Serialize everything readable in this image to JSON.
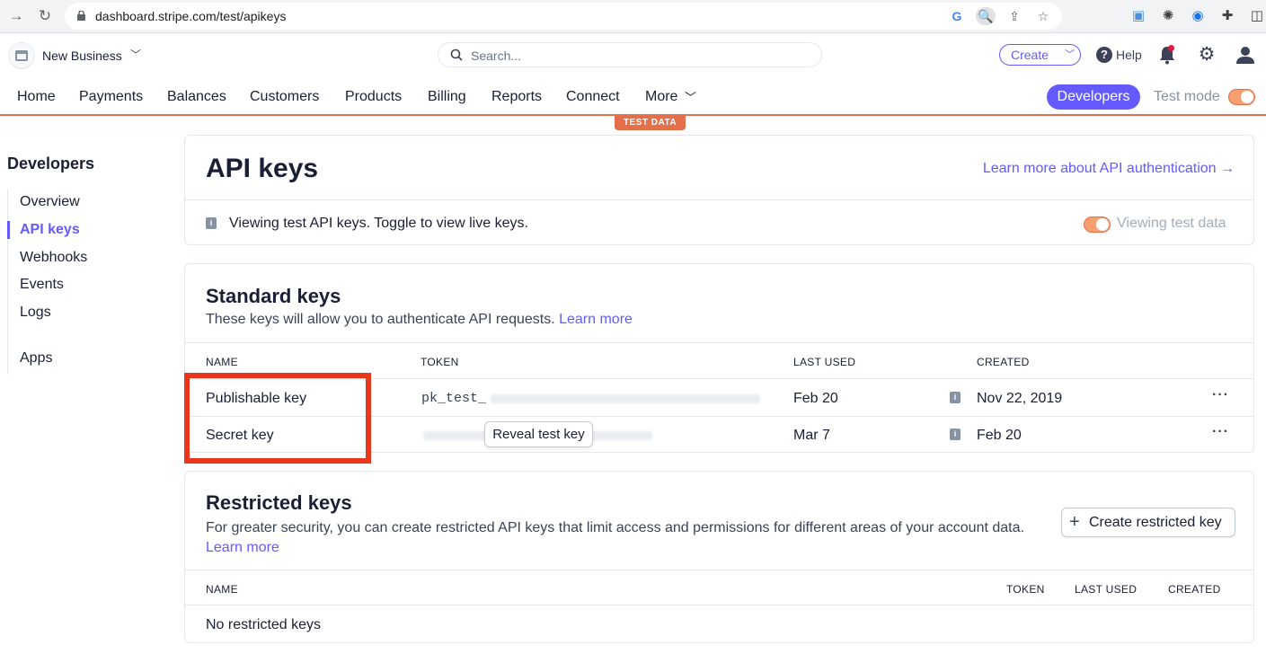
{
  "browser": {
    "url": "dashboard.stripe.com/test/apikeys"
  },
  "header": {
    "business_name": "New Business",
    "search_placeholder": "Search...",
    "create_label": "Create",
    "help_label": "Help"
  },
  "nav": {
    "items": [
      "Home",
      "Payments",
      "Balances",
      "Customers",
      "Products",
      "Billing",
      "Reports",
      "Connect",
      "More"
    ],
    "developers_label": "Developers",
    "test_mode_label": "Test mode",
    "test_badge": "TEST DATA"
  },
  "sidebar": {
    "title": "Developers",
    "items": [
      "Overview",
      "API keys",
      "Webhooks",
      "Events",
      "Logs",
      "Apps"
    ]
  },
  "api_card": {
    "title": "API keys",
    "learn_more": "Learn more about API authentication →",
    "info_text": "Viewing test API keys. Toggle to view live keys.",
    "viewing_label": "Viewing test data"
  },
  "standard": {
    "title": "Standard keys",
    "desc": "These keys will allow you to authenticate API requests.",
    "learn_more": "Learn more",
    "columns": [
      "NAME",
      "TOKEN",
      "LAST USED",
      "CREATED"
    ],
    "rows": [
      {
        "name": "Publishable key",
        "token": "pk_test_",
        "last_used": "Feb 20",
        "created": "Nov 22, 2019"
      },
      {
        "name": "Secret key",
        "token": "",
        "last_used": "Mar 7",
        "created": "Feb 20"
      }
    ],
    "reveal_label": "Reveal test key"
  },
  "restricted": {
    "title": "Restricted keys",
    "desc": "For greater security, you can create restricted API keys that limit access and permissions for different areas of your account data.",
    "learn_more": "Learn more",
    "create_label": "Create restricted key",
    "columns": [
      "NAME",
      "TOKEN",
      "LAST USED",
      "CREATED"
    ],
    "empty": "No restricted keys"
  },
  "colors": {
    "accent": "#635bff",
    "test_orange": "#e56f4a",
    "highlight": "#e8371d"
  }
}
